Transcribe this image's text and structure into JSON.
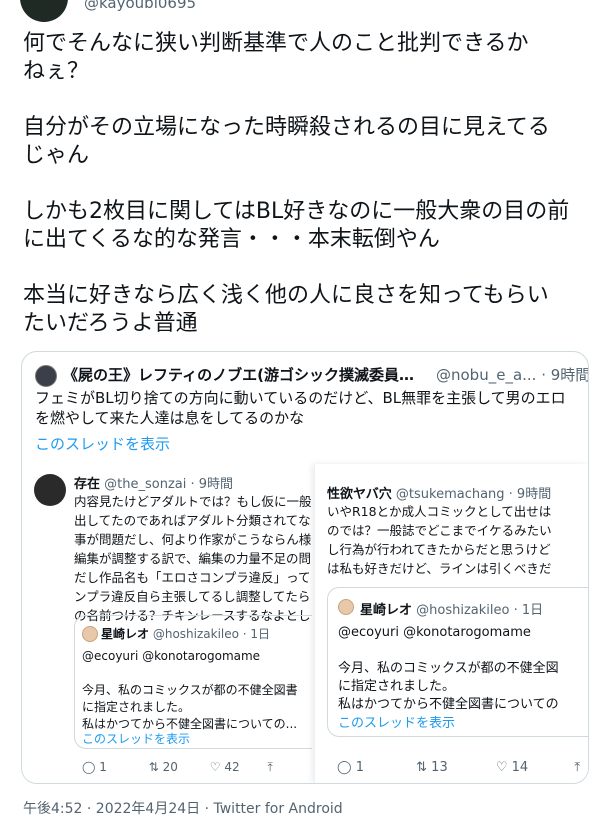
{
  "author": {
    "handle_partial": "@kayoubi0695"
  },
  "tweet": {
    "paragraphs": [
      "何でそんなに狭い判断基準で人のこと批判できるか\nねぇ？",
      "自分がその立場になった時瞬殺されるの目に見えてる\nじゃん",
      "しかも2枚目に関してはBL好きなのに一般大衆の目の前\nに出てくるな的な発言・・・本末転倒やん",
      "本当に好きなら広く浅く他の人に良さを知ってもらい\nたいだろうよ普通"
    ]
  },
  "quote": {
    "name": "《屍の王》レフティのノブエ(游ゴシック撲滅委員会...",
    "handle_time": "@nobu_e_a... · 9時間",
    "text": "フェミがBL切り捨ての方向に動いているのだけど、BL無罪を主張して男のエロを燃やして来た人達は息をしてるのかな",
    "show_thread": "このスレッドを表示"
  },
  "shot_left": {
    "name": "存在",
    "handle_time": "@the_sonzai · 9時間",
    "lines": [
      "内容見たけどアダルトでは？もし仮に一般",
      "出してたのであればアダルト分類されてな",
      "事が問題だし、何より作家がこうならん様",
      "編集が調整する訳で、編集の力量不足の問",
      "だし作品名も「エロさコンプラ違反」って",
      "ンプラ違反自ら主張してるし調整してたら",
      "の名前つける？チキンレースするなよとし"
    ],
    "inner_name": "星崎レオ",
    "inner_handle_time": "@hoshizakileo · 1日",
    "inner_lines": [
      "@ecoyuri @konotarogomame",
      "",
      "今月、私のコミックスが都の不健全図書",
      "に指定されました。",
      "私はかつてから不健全図書についての..."
    ],
    "inner_thread": "このスレッドを表示",
    "reply_count": "1",
    "retweet_count": "20",
    "like_count": "42"
  },
  "shot_right": {
    "name": "性欲ヤバ穴",
    "handle_time": "@tsukemachang · 9時間",
    "lines": [
      "いやR18とか成人コミックとして出せは",
      "のでは？一般誌でどこまでイケるみたい",
      "し行為が行われてきたからだと思うけど",
      "は私も好きだけど、ラインは引くべきだ"
    ],
    "inner_name": "星崎レオ",
    "inner_handle_time": "@hoshizakileo · 1日",
    "inner_lines": [
      "@ecoyuri @konotarogomame",
      "",
      "今月、私のコミックスが都の不健全図",
      "に指定されました。",
      "私はかつてから不健全図書についての"
    ],
    "inner_thread": "このスレッドを表示",
    "reply_count": "1",
    "retweet_count": "13",
    "like_count": "14"
  },
  "footer": {
    "meta": "午後4:52 · 2022年4月24日 · Twitter for Android"
  },
  "icons": {
    "reply": "reply-icon",
    "retweet": "retweet-icon",
    "like": "like-icon",
    "share": "share-icon"
  }
}
